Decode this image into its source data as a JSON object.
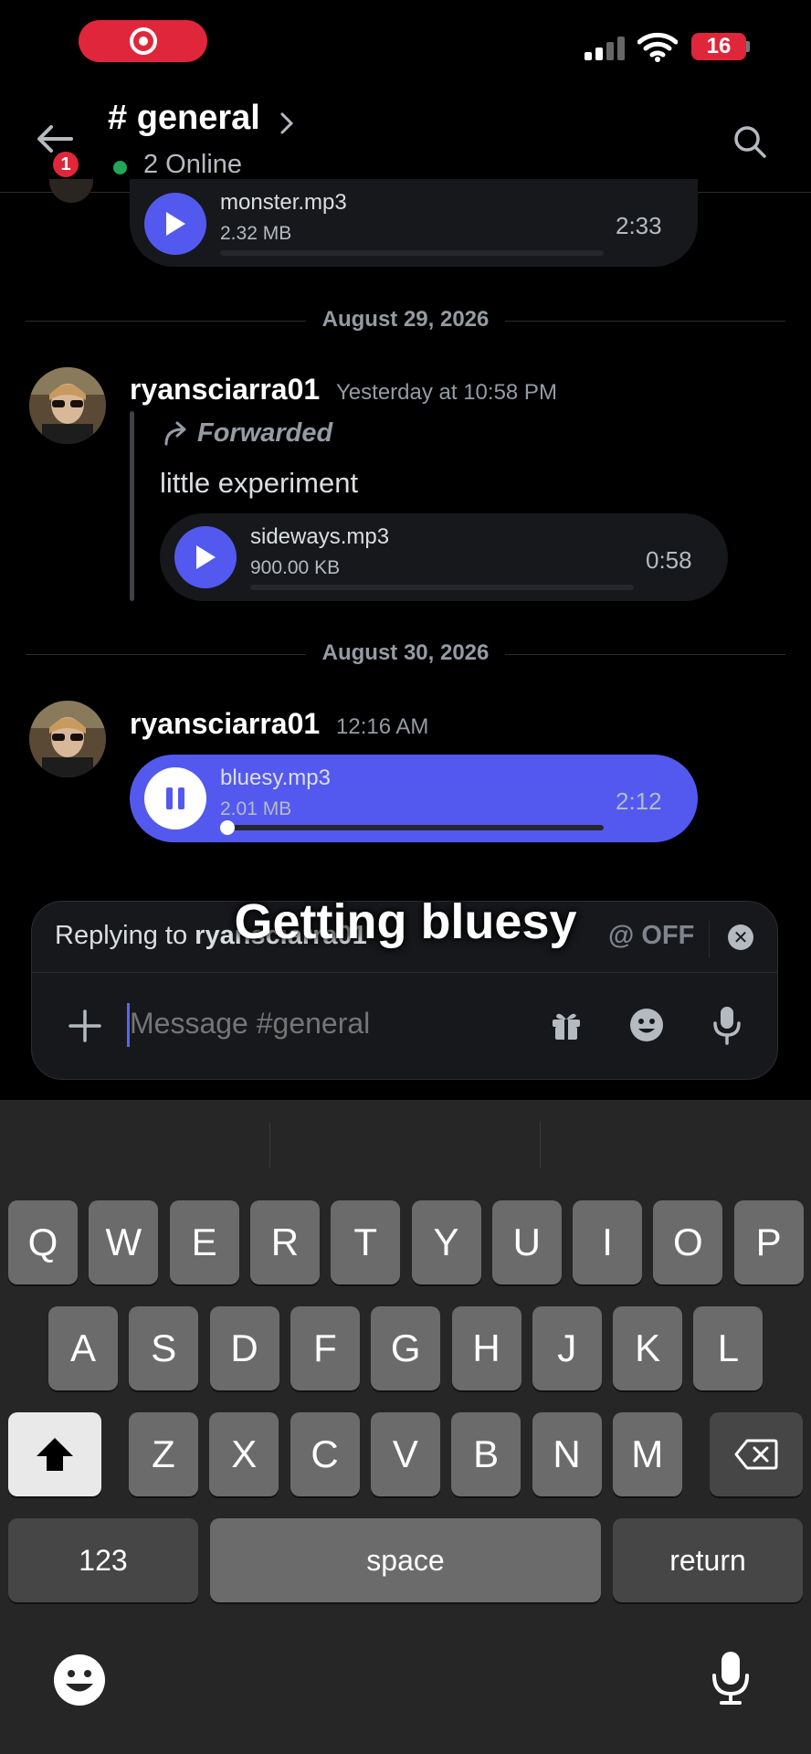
{
  "status_bar": {
    "battery": "16"
  },
  "header": {
    "back_badge": "1",
    "channel": "# general",
    "online": "2 Online"
  },
  "messages": {
    "first_audio": {
      "name": "monster.mp3",
      "size": "2.32 MB",
      "duration": "2:33"
    },
    "divider_1": "August 29, 2026",
    "msg_1": {
      "user": "ryansciarra01",
      "time": "Yesterday at 10:58 PM",
      "forwarded": "Forwarded",
      "text": "little experiment",
      "audio": {
        "name": "sideways.mp3",
        "size": "900.00 KB",
        "duration": "0:58"
      }
    },
    "divider_2": "August 30, 2026",
    "msg_2": {
      "user": "ryansciarra01",
      "time": "12:16 AM",
      "audio": {
        "name": "bluesy.mp3",
        "size": "2.01 MB",
        "duration": "2:12",
        "progress": 0.02
      }
    }
  },
  "caption": "Getting bluesy",
  "composer": {
    "replying_prefix": "Replying to ",
    "replying_user": "ryansciarra01",
    "mention_toggle": "@ OFF",
    "placeholder": "Message #general"
  },
  "keyboard": {
    "row1": [
      "Q",
      "W",
      "E",
      "R",
      "T",
      "Y",
      "U",
      "I",
      "O",
      "P"
    ],
    "row2": [
      "A",
      "S",
      "D",
      "F",
      "G",
      "H",
      "J",
      "K",
      "L"
    ],
    "row3": [
      "Z",
      "X",
      "C",
      "V",
      "B",
      "N",
      "M"
    ],
    "numbers": "123",
    "space": "space",
    "return": "return"
  },
  "colors": {
    "accent": "#5359ef",
    "recording": "#e0263a",
    "online": "#23a55a"
  }
}
